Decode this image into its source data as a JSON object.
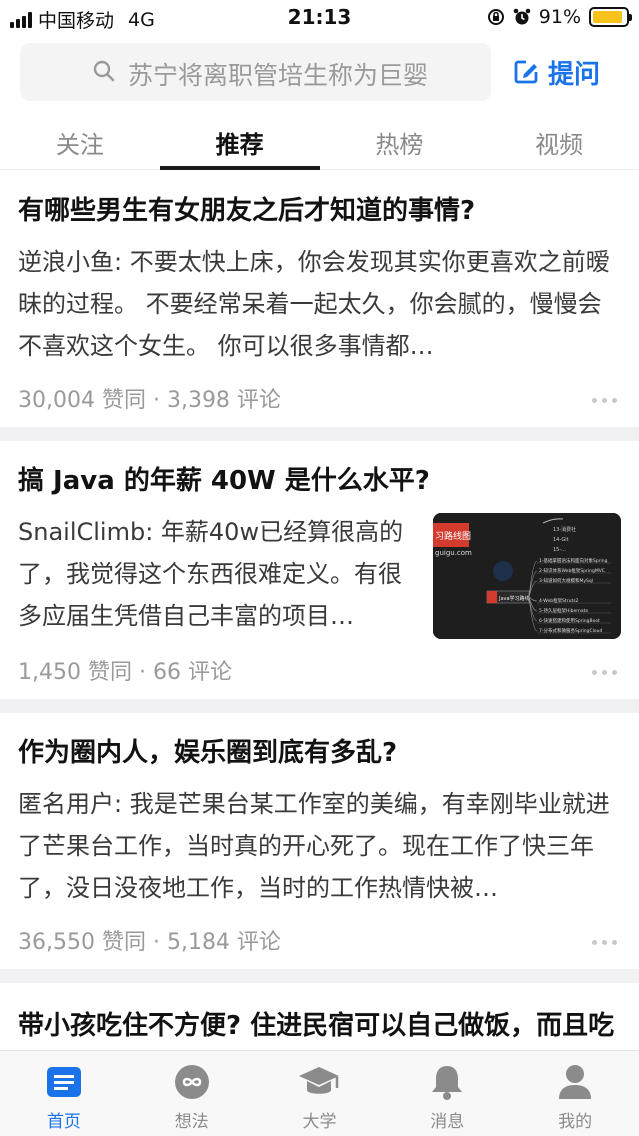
{
  "status_bar": {
    "carrier": "中国移动",
    "network": "4G",
    "time": "21:13",
    "battery": "91%",
    "battery_level": 0.91
  },
  "search": {
    "placeholder": "苏宁将离职管培生称为巨婴",
    "ask_label": "提问"
  },
  "tabs": [
    {
      "label": "关注"
    },
    {
      "label": "推荐"
    },
    {
      "label": "热榜"
    },
    {
      "label": "视频"
    }
  ],
  "feed": [
    {
      "title": "有哪些男生有女朋友之后才知道的事情?",
      "excerpt": "逆浪小鱼: 不要太快上床，你会发现其实你更喜欢之前暧昧的过程。 不要经常呆着一起太久，你会腻的，慢慢会不喜欢这个女生。 你可以很多事情都…",
      "meta": "30,004 赞同 · 3,398 评论"
    },
    {
      "title": "搞 Java 的年薪 40W 是什么水平?",
      "excerpt": "SnailClimb: 年薪40w已经算很高的了，我觉得这个东西很难定义。有很多应届生凭借自己丰富的项目…",
      "meta": "1,450 赞同 · 66 评论",
      "thumb": {
        "header_text": "习路线图",
        "site_text": "guigu.com",
        "node_label": "Java学习路线",
        "branches": [
          "1-基础掌握语法和面向对象Spring",
          "2-知识体系Web框架SpringMVC",
          "3-知道如何大规模和MySql",
          "4-Web框架Struts2",
          "5-持久层框架Hibernate",
          "6-快速搭建和使用SpringBoot",
          "7-分布式和微服务SpringCloud"
        ],
        "top_branches": [
          "13-消费社",
          "14-Git",
          "15-..."
        ]
      }
    },
    {
      "title": "作为圈内人，娱乐圈到底有多乱?",
      "excerpt": "匿名用户: 我是芒果台某工作室的美编，有幸刚毕业就进了芒果台工作，当时真的开心死了。现在工作了快三年了，没日没夜地工作，当时的工作热情快被…",
      "meta": "36,550 赞同 · 5,184 评论"
    },
    {
      "title": "带小孩吃住不方便? 住进民宿可以自己做饭，而且吃的放心"
    }
  ],
  "bottom_nav": [
    {
      "label": "首页",
      "icon": "home-icon",
      "active": true
    },
    {
      "label": "想法",
      "icon": "idea-icon"
    },
    {
      "label": "大学",
      "icon": "graduation-cap-icon"
    },
    {
      "label": "消息",
      "icon": "bell-icon"
    },
    {
      "label": "我的",
      "icon": "profile-icon"
    }
  ],
  "colors": {
    "accent": "#1a73e8",
    "battery": "#f6c21b"
  }
}
